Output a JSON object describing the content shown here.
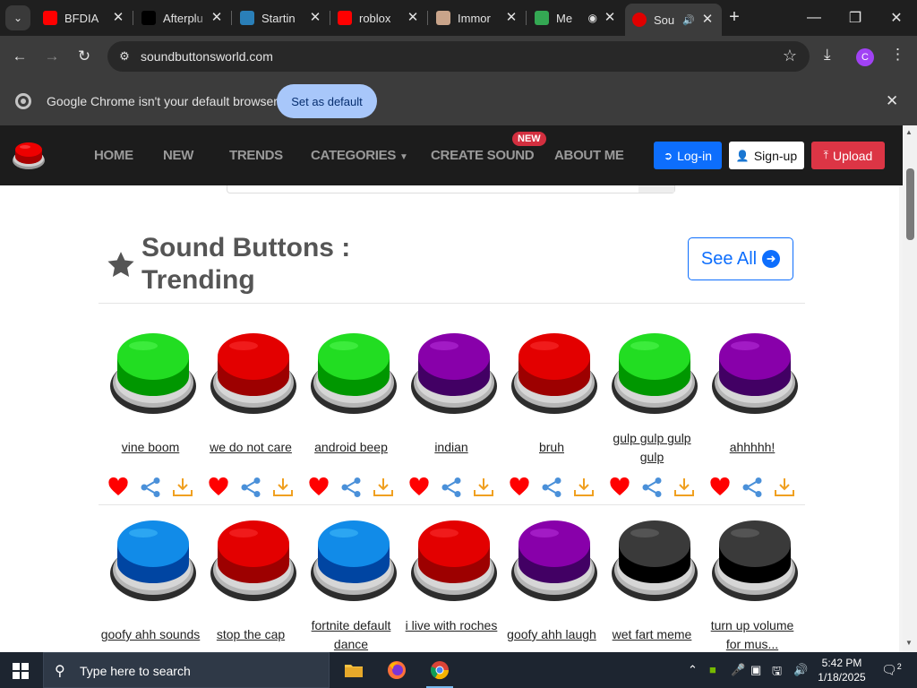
{
  "browser": {
    "tabs": [
      {
        "title": "BFDIA",
        "favicon": "youtube-icon",
        "color": "#ff0000"
      },
      {
        "title": "Afterplu",
        "favicon": "afterplay-icon",
        "color": "#000000"
      },
      {
        "title": "Startin",
        "favicon": "c-logo-icon",
        "color": "#2a7fb8"
      },
      {
        "title": "roblox",
        "favicon": "youtube-icon",
        "color": "#ff0000"
      },
      {
        "title": "Immor",
        "favicon": "avatar-icon",
        "color": "#c9a48a"
      },
      {
        "title": "Me",
        "favicon": "meet-icon",
        "color": "#34a853"
      },
      {
        "title": "Sou",
        "favicon": "red-button-icon",
        "color": "#e00000"
      }
    ],
    "url": "soundbuttonsworld.com",
    "profile_initial": "C",
    "infobar": {
      "message": "Google Chrome isn't your default browser",
      "button": "Set as default"
    }
  },
  "site": {
    "nav": [
      "HOME",
      "NEW",
      "TRENDS",
      "CATEGORIES",
      "CREATE SOUND",
      "ABOUT ME"
    ],
    "new_badge": "NEW",
    "login": "Log-in",
    "signup": "Sign-up",
    "upload": "Upload",
    "section_title": "Sound Buttons : Trending",
    "see_all": "See All"
  },
  "colors": {
    "green": "#22dd22",
    "red": "#e30000",
    "purple": "#8800aa",
    "blue": "#118be8",
    "gray": "#3a3a3a"
  },
  "sounds": [
    {
      "name": "vine boom",
      "color": "green"
    },
    {
      "name": "we do not care",
      "color": "red"
    },
    {
      "name": "android beep",
      "color": "green"
    },
    {
      "name": "indian",
      "color": "purple"
    },
    {
      "name": "bruh",
      "color": "red"
    },
    {
      "name": "gulp gulp gulp gulp",
      "color": "green"
    },
    {
      "name": "ahhhhh!",
      "color": "purple"
    },
    {
      "name": "goofy ahh sounds",
      "color": "blue"
    },
    {
      "name": "stop the cap",
      "color": "red"
    },
    {
      "name": "fortnite default dance",
      "color": "blue"
    },
    {
      "name": "i live with roches",
      "color": "red"
    },
    {
      "name": "goofy ahh laugh",
      "color": "purple"
    },
    {
      "name": "wet fart meme",
      "color": "gray"
    },
    {
      "name": "turn up volume for mus...",
      "color": "gray"
    }
  ],
  "taskbar": {
    "search_placeholder": "Type here to search",
    "time": "5:42 PM",
    "date": "1/18/2025",
    "notifications": "2"
  }
}
